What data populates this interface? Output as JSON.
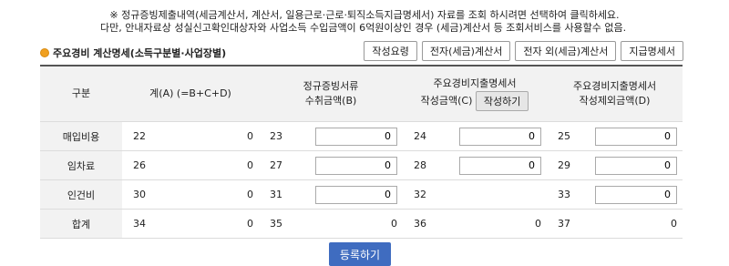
{
  "notice": {
    "line1": "※ 정규증빙제출내역(세금계산서, 계산서, 일용근로·근로·퇴직소득지급명세서) 자료를 조회 하시려면 선택하여 클릭하세요.",
    "line2": "다만, 안내자료상 성실신고확인대상자와 사업소득 수입금액이 6억원이상인 경우 (세금)계산서 등 조회서비스를 사용할수 없음."
  },
  "section": {
    "title": "주요경비 계산명세(소득구분별·사업장별)"
  },
  "buttons": {
    "guide": "작성요령",
    "e_tax_invoice": "전자(세금)계산서",
    "non_e_tax_invoice": "전자 외(세금)계산서",
    "payment_statement": "지급명세서",
    "write": "작성하기",
    "register": "등록하기"
  },
  "table": {
    "headers": {
      "category": "구분",
      "total": "계(A) (=B+C+D)",
      "formal_line1": "정규증빙서류",
      "formal_line2": "수취금액(B)",
      "main_stmt_line1": "주요경비지출명세서",
      "main_stmt_line2": "작성금액(C)",
      "excluded_line1": "주요경비지출명세서",
      "excluded_line2": "작성제외금액(D)"
    },
    "rows": [
      {
        "label": "매입비용",
        "n1": "22",
        "v1": "0",
        "n2": "23",
        "v2": "0",
        "n3": "24",
        "v3": "0",
        "n4": "25",
        "v4": "0"
      },
      {
        "label": "임차료",
        "n1": "26",
        "v1": "0",
        "n2": "27",
        "v2": "0",
        "n3": "28",
        "v3": "0",
        "n4": "29",
        "v4": "0"
      },
      {
        "label": "인건비",
        "n1": "30",
        "v1": "0",
        "n2": "31",
        "v2": "0",
        "n3": "32",
        "v3": "",
        "n4": "33",
        "v4": "0"
      },
      {
        "label": "합계",
        "n1": "34",
        "v1": "0",
        "n2": "35",
        "v2": "0",
        "n3": "36",
        "v3": "0",
        "n4": "37",
        "v4": "0"
      }
    ]
  },
  "colors": {
    "accent_button": "#3f6cc0",
    "section_dot": "#f0a020"
  }
}
